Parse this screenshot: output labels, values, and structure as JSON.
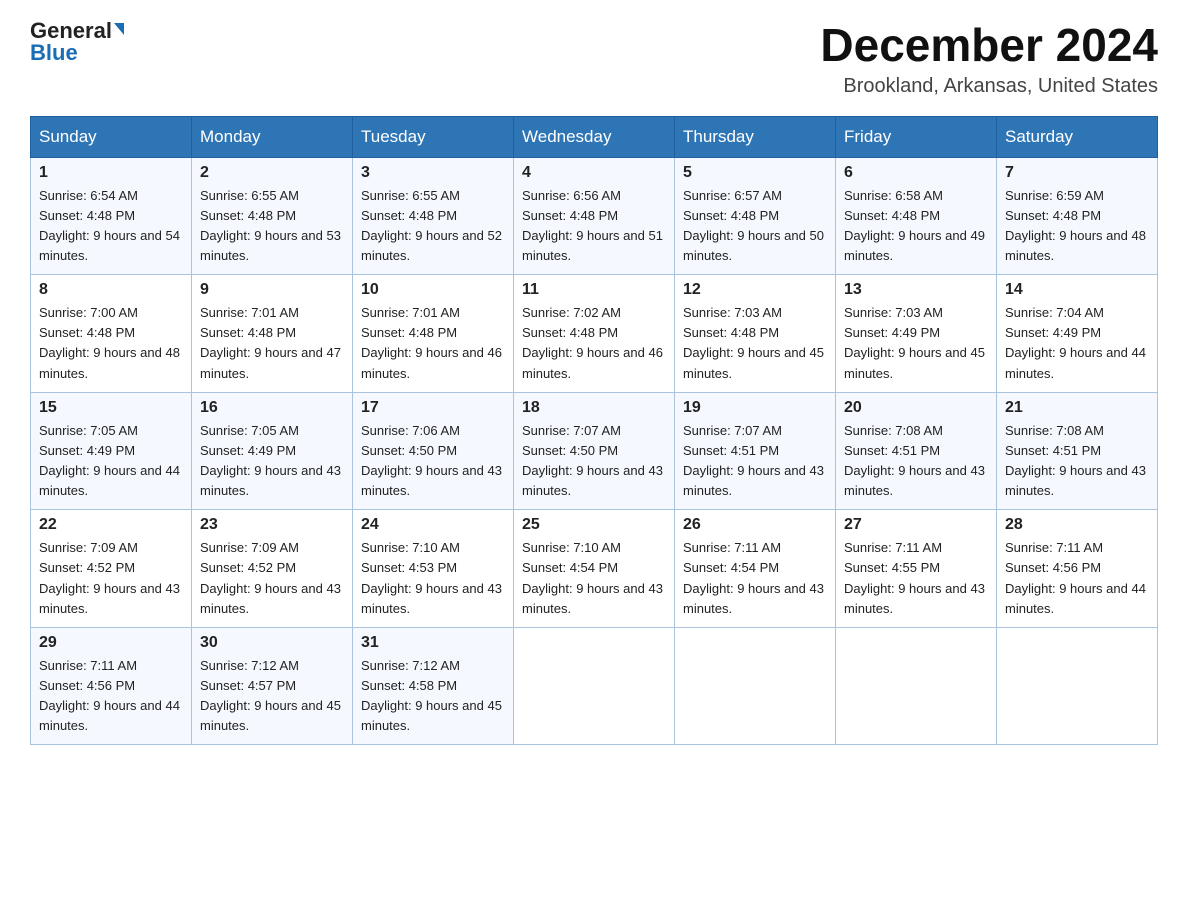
{
  "header": {
    "logo_general": "General",
    "logo_blue": "Blue",
    "month_title": "December 2024",
    "location": "Brookland, Arkansas, United States"
  },
  "weekdays": [
    "Sunday",
    "Monday",
    "Tuesday",
    "Wednesday",
    "Thursday",
    "Friday",
    "Saturday"
  ],
  "weeks": [
    [
      {
        "day": "1",
        "sunrise": "6:54 AM",
        "sunset": "4:48 PM",
        "daylight": "9 hours and 54 minutes."
      },
      {
        "day": "2",
        "sunrise": "6:55 AM",
        "sunset": "4:48 PM",
        "daylight": "9 hours and 53 minutes."
      },
      {
        "day": "3",
        "sunrise": "6:55 AM",
        "sunset": "4:48 PM",
        "daylight": "9 hours and 52 minutes."
      },
      {
        "day": "4",
        "sunrise": "6:56 AM",
        "sunset": "4:48 PM",
        "daylight": "9 hours and 51 minutes."
      },
      {
        "day": "5",
        "sunrise": "6:57 AM",
        "sunset": "4:48 PM",
        "daylight": "9 hours and 50 minutes."
      },
      {
        "day": "6",
        "sunrise": "6:58 AM",
        "sunset": "4:48 PM",
        "daylight": "9 hours and 49 minutes."
      },
      {
        "day": "7",
        "sunrise": "6:59 AM",
        "sunset": "4:48 PM",
        "daylight": "9 hours and 48 minutes."
      }
    ],
    [
      {
        "day": "8",
        "sunrise": "7:00 AM",
        "sunset": "4:48 PM",
        "daylight": "9 hours and 48 minutes."
      },
      {
        "day": "9",
        "sunrise": "7:01 AM",
        "sunset": "4:48 PM",
        "daylight": "9 hours and 47 minutes."
      },
      {
        "day": "10",
        "sunrise": "7:01 AM",
        "sunset": "4:48 PM",
        "daylight": "9 hours and 46 minutes."
      },
      {
        "day": "11",
        "sunrise": "7:02 AM",
        "sunset": "4:48 PM",
        "daylight": "9 hours and 46 minutes."
      },
      {
        "day": "12",
        "sunrise": "7:03 AM",
        "sunset": "4:48 PM",
        "daylight": "9 hours and 45 minutes."
      },
      {
        "day": "13",
        "sunrise": "7:03 AM",
        "sunset": "4:49 PM",
        "daylight": "9 hours and 45 minutes."
      },
      {
        "day": "14",
        "sunrise": "7:04 AM",
        "sunset": "4:49 PM",
        "daylight": "9 hours and 44 minutes."
      }
    ],
    [
      {
        "day": "15",
        "sunrise": "7:05 AM",
        "sunset": "4:49 PM",
        "daylight": "9 hours and 44 minutes."
      },
      {
        "day": "16",
        "sunrise": "7:05 AM",
        "sunset": "4:49 PM",
        "daylight": "9 hours and 43 minutes."
      },
      {
        "day": "17",
        "sunrise": "7:06 AM",
        "sunset": "4:50 PM",
        "daylight": "9 hours and 43 minutes."
      },
      {
        "day": "18",
        "sunrise": "7:07 AM",
        "sunset": "4:50 PM",
        "daylight": "9 hours and 43 minutes."
      },
      {
        "day": "19",
        "sunrise": "7:07 AM",
        "sunset": "4:51 PM",
        "daylight": "9 hours and 43 minutes."
      },
      {
        "day": "20",
        "sunrise": "7:08 AM",
        "sunset": "4:51 PM",
        "daylight": "9 hours and 43 minutes."
      },
      {
        "day": "21",
        "sunrise": "7:08 AM",
        "sunset": "4:51 PM",
        "daylight": "9 hours and 43 minutes."
      }
    ],
    [
      {
        "day": "22",
        "sunrise": "7:09 AM",
        "sunset": "4:52 PM",
        "daylight": "9 hours and 43 minutes."
      },
      {
        "day": "23",
        "sunrise": "7:09 AM",
        "sunset": "4:52 PM",
        "daylight": "9 hours and 43 minutes."
      },
      {
        "day": "24",
        "sunrise": "7:10 AM",
        "sunset": "4:53 PM",
        "daylight": "9 hours and 43 minutes."
      },
      {
        "day": "25",
        "sunrise": "7:10 AM",
        "sunset": "4:54 PM",
        "daylight": "9 hours and 43 minutes."
      },
      {
        "day": "26",
        "sunrise": "7:11 AM",
        "sunset": "4:54 PM",
        "daylight": "9 hours and 43 minutes."
      },
      {
        "day": "27",
        "sunrise": "7:11 AM",
        "sunset": "4:55 PM",
        "daylight": "9 hours and 43 minutes."
      },
      {
        "day": "28",
        "sunrise": "7:11 AM",
        "sunset": "4:56 PM",
        "daylight": "9 hours and 44 minutes."
      }
    ],
    [
      {
        "day": "29",
        "sunrise": "7:11 AM",
        "sunset": "4:56 PM",
        "daylight": "9 hours and 44 minutes."
      },
      {
        "day": "30",
        "sunrise": "7:12 AM",
        "sunset": "4:57 PM",
        "daylight": "9 hours and 45 minutes."
      },
      {
        "day": "31",
        "sunrise": "7:12 AM",
        "sunset": "4:58 PM",
        "daylight": "9 hours and 45 minutes."
      },
      null,
      null,
      null,
      null
    ]
  ]
}
